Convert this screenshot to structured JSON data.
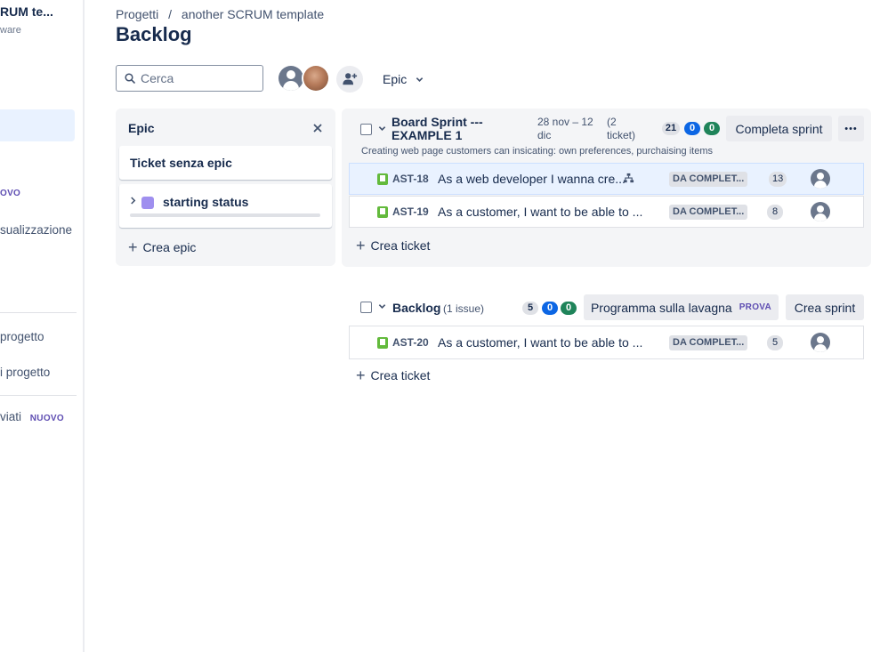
{
  "sidebar": {
    "project_name": "RUM te...",
    "project_type": "ware",
    "new_badge": "OVO",
    "item_visualization": "sualizzazione",
    "item_project1": "progetto",
    "item_project2": "i progetto",
    "item_sent": "viati",
    "item_sent_badge": "NUOVO"
  },
  "breadcrumb": {
    "root": "Progetti",
    "separator": "/",
    "project": "another SCRUM template"
  },
  "page_title": "Backlog",
  "search": {
    "placeholder": "Cerca",
    "value": ""
  },
  "filters": {
    "epic_label": "Epic"
  },
  "epic_panel": {
    "title": "Epic",
    "no_epic": "Ticket senza epic",
    "epics": [
      {
        "name": "starting status",
        "color": "#9f8fef"
      }
    ],
    "create_label": "Crea epic"
  },
  "sprint": {
    "name": "Board Sprint --- EXAMPLE 1",
    "name_line1": "Board Sprint ---",
    "name_line2": "EXAMPLE 1",
    "dates_line1": "28 nov – 12",
    "dates_line2": "dic",
    "count_line1": "(2",
    "count_line2": "ticket)",
    "points": {
      "todo": "21",
      "in_progress": "0",
      "done": "0"
    },
    "complete_button": "Completa sprint",
    "more_button": "•••",
    "goal": "Creating web page customers can insicating: own preferences, purchaising items",
    "issues": [
      {
        "key": "AST-18",
        "summary": "As a web developer I wanna cre...",
        "status": "DA COMPLET...",
        "points": "13",
        "has_children": true
      },
      {
        "key": "AST-19",
        "summary": "As a customer, I want to be able to ...",
        "status": "DA COMPLET...",
        "points": "8",
        "has_children": false
      }
    ],
    "create_ticket": "Crea ticket"
  },
  "backlog": {
    "name": "Backlog",
    "count": "(1 issue)",
    "points": {
      "todo": "5",
      "in_progress": "0",
      "done": "0"
    },
    "board_button": "Programma sulla lavagna",
    "board_badge": "PROVA",
    "create_sprint_button": "Crea sprint",
    "issues": [
      {
        "key": "AST-20",
        "summary": "As a customer, I want to be able to ...",
        "status": "DA COMPLET...",
        "points": "5"
      }
    ],
    "create_ticket": "Crea ticket"
  },
  "colors": {
    "accent_blue": "#0c66e4",
    "done_green": "#1f845a",
    "story_green": "#63ba3c",
    "selected_bg": "#e9f2ff"
  }
}
